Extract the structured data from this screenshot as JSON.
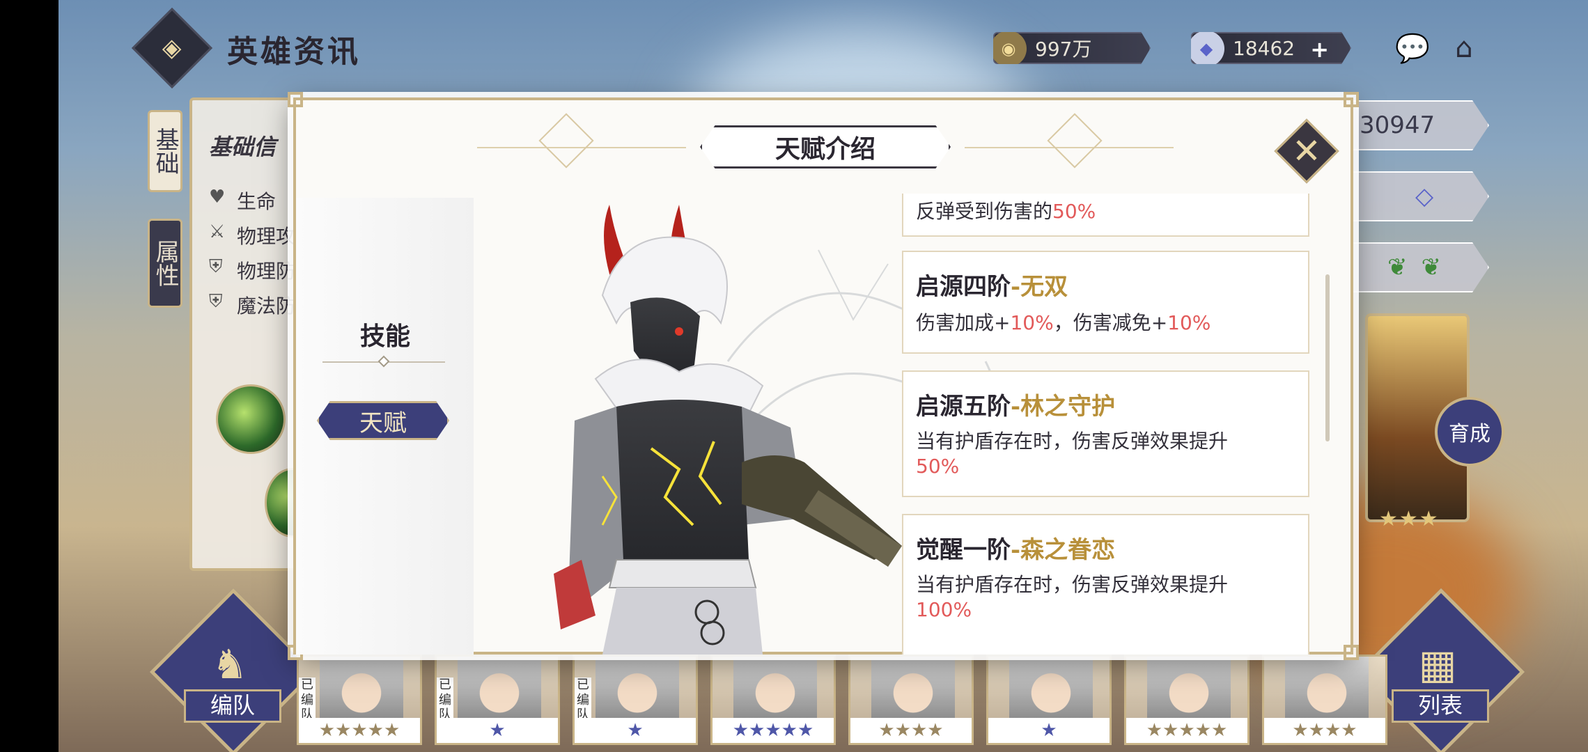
{
  "header": {
    "title": "英雄资讯",
    "gold_amount": "997万",
    "gem_amount": "18462",
    "plus_label": "+"
  },
  "background_panel": {
    "tab_basic": "基础",
    "tab_attr": "属性",
    "section_title": "基础信",
    "stats": [
      "生命",
      "物理攻",
      "物理防",
      "魔法防"
    ],
    "right_value": "30947"
  },
  "modal": {
    "title": "天赋介绍",
    "nav": {
      "skill_label": "技能",
      "talent_label": "天赋"
    },
    "talents": [
      {
        "desc_prefix": "反弹受到伤害的",
        "desc_value": "50%"
      },
      {
        "name_prefix": "启源四阶",
        "name_accent": "-无双",
        "desc_a": "伤害加成+",
        "desc_a_val": "10%",
        "desc_b": "，伤害减免+",
        "desc_b_val": "10%"
      },
      {
        "name_prefix": "启源五阶",
        "name_accent": "-林之守护",
        "desc_line1": "当有护盾存在时，伤害反弹效果提升",
        "desc_value": "50%"
      },
      {
        "name_prefix": "觉醒一阶",
        "name_accent": "-森之眷恋",
        "desc_line1": "当有护盾存在时，伤害反弹效果提升",
        "desc_value": "100%"
      }
    ]
  },
  "dock": {
    "team_label": "编队",
    "list_label": "列表",
    "grow_label": "育成"
  },
  "roster": {
    "tag": "已编队",
    "cards": [
      {
        "stars": "★★★★★",
        "color": "gold",
        "tag": true
      },
      {
        "stars": "★",
        "color": "blue",
        "tag": true
      },
      {
        "stars": "★",
        "color": "blue",
        "tag": true
      },
      {
        "stars": "★★★★★",
        "color": "blue",
        "tag": false
      },
      {
        "stars": "★★★★",
        "color": "gold",
        "tag": false
      },
      {
        "stars": "★",
        "color": "blue",
        "tag": false
      },
      {
        "stars": "★★★★★",
        "color": "gold",
        "tag": false
      },
      {
        "stars": "★★★★",
        "color": "gold",
        "tag": false
      }
    ]
  },
  "colors": {
    "accent_gold": "#c9b487",
    "nav_blue": "#3c3f7a",
    "highlight_red": "#e25a5a",
    "talent_accent": "#b8903a"
  }
}
